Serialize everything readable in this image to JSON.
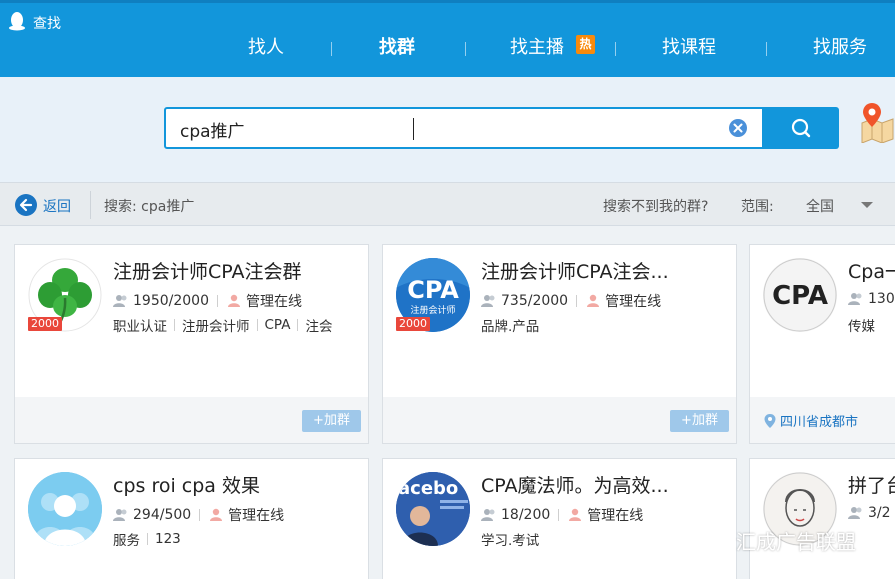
{
  "window": {
    "title": "查找"
  },
  "nav": {
    "items": [
      {
        "label": "找人"
      },
      {
        "label": "找群"
      },
      {
        "label": "找主播",
        "badge": "热"
      },
      {
        "label": "找课程"
      },
      {
        "label": "找服务"
      }
    ]
  },
  "search": {
    "value": "cpa推广"
  },
  "filter": {
    "back": "返回",
    "echo": "搜索: cpa推广",
    "notfound": "搜索不到我的群?",
    "range_label": "范围:",
    "range_value": "全国"
  },
  "cards": [
    {
      "title": "注册会计师CPA注会群",
      "members": "1950/2000",
      "admin": "管理在线",
      "tags": [
        "职业认证",
        "注册会计师",
        "CPA",
        "注会"
      ],
      "level": "2000",
      "join": "+加群"
    },
    {
      "title": "注册会计师CPA注会...",
      "members": "735/2000",
      "admin": "管理在线",
      "tags": [
        "品牌.产品"
      ],
      "level": "2000",
      "join": "+加群",
      "avatar_text": "CPA",
      "avatar_sub": "注册会计师"
    },
    {
      "title": "Cpa一",
      "members": "130",
      "tags": [
        "传媒"
      ],
      "location": "四川省成都市",
      "avatar_text": "CPA"
    },
    {
      "title": "cps roi cpa 效果",
      "members": "294/500",
      "admin": "管理在线",
      "tags": [
        "服务",
        "123"
      ]
    },
    {
      "title": "CPA魔法师。为高效...",
      "members": "18/200",
      "admin": "管理在线",
      "tags": [
        "学习.考试"
      ],
      "avatar_text": "acebo"
    },
    {
      "title": "拼了台",
      "members": "3/2"
    }
  ],
  "watermark": {
    "text": "汇成广告联盟"
  },
  "colors": {
    "brand": "#1296db",
    "badge_red": "#e9473b",
    "hot": "#f88a0c"
  }
}
